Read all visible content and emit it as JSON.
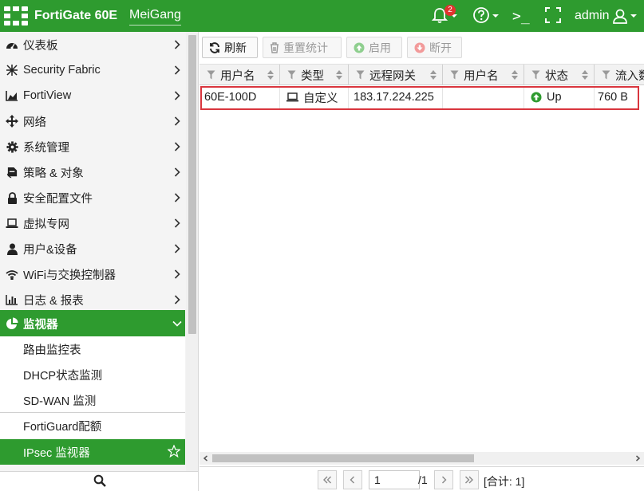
{
  "colors": {
    "brand_green": "#2e9b2f",
    "highlight_red": "#d9363e",
    "status_up_green": "#2e9b2f",
    "badge_red": "#e0342f"
  },
  "header": {
    "brand": "FortiGate 60E",
    "hostname": "MeiGang",
    "notification_count": "2",
    "cli_glyph": ">_",
    "user": "admin"
  },
  "sidebar": {
    "items": [
      {
        "label": "仪表板",
        "icon": "dashboard-icon"
      },
      {
        "label": "Security Fabric",
        "icon": "fabric-icon"
      },
      {
        "label": "FortiView",
        "icon": "chart-icon"
      },
      {
        "label": "网络",
        "icon": "network-icon"
      },
      {
        "label": "系统管理",
        "icon": "gear-icon"
      },
      {
        "label": "策略 & 对象",
        "icon": "policy-icon"
      },
      {
        "label": "安全配置文件",
        "icon": "lock-icon"
      },
      {
        "label": "虚拟专网",
        "icon": "laptop-icon"
      },
      {
        "label": "用户&设备",
        "icon": "user-icon"
      },
      {
        "label": "WiFi与交换控制器",
        "icon": "wifi-icon"
      },
      {
        "label": "日志 & 报表",
        "icon": "bar-chart-icon"
      },
      {
        "label": "监视器",
        "icon": "pie-chart-icon"
      }
    ],
    "monitor_sub": [
      "路由监控表",
      "DHCP状态监测",
      "SD-WAN 监测",
      "FortiGuard配额",
      "IPsec 监视器"
    ]
  },
  "toolbar": {
    "refresh": "刷新",
    "reset_stats": "重置统计",
    "enable": "启用",
    "disconnect": "断开"
  },
  "table": {
    "columns": [
      "用户名",
      "类型",
      "远程网关",
      "用户名",
      "状态",
      "流入数"
    ],
    "rows": [
      {
        "name": "60E-100D",
        "type": "自定义",
        "remote_gateway": "183.17.224.225",
        "username": "",
        "status": "Up",
        "incoming": "760 B"
      }
    ]
  },
  "pager": {
    "page": "1",
    "total": "/1",
    "summary": "[合计: 1]"
  }
}
